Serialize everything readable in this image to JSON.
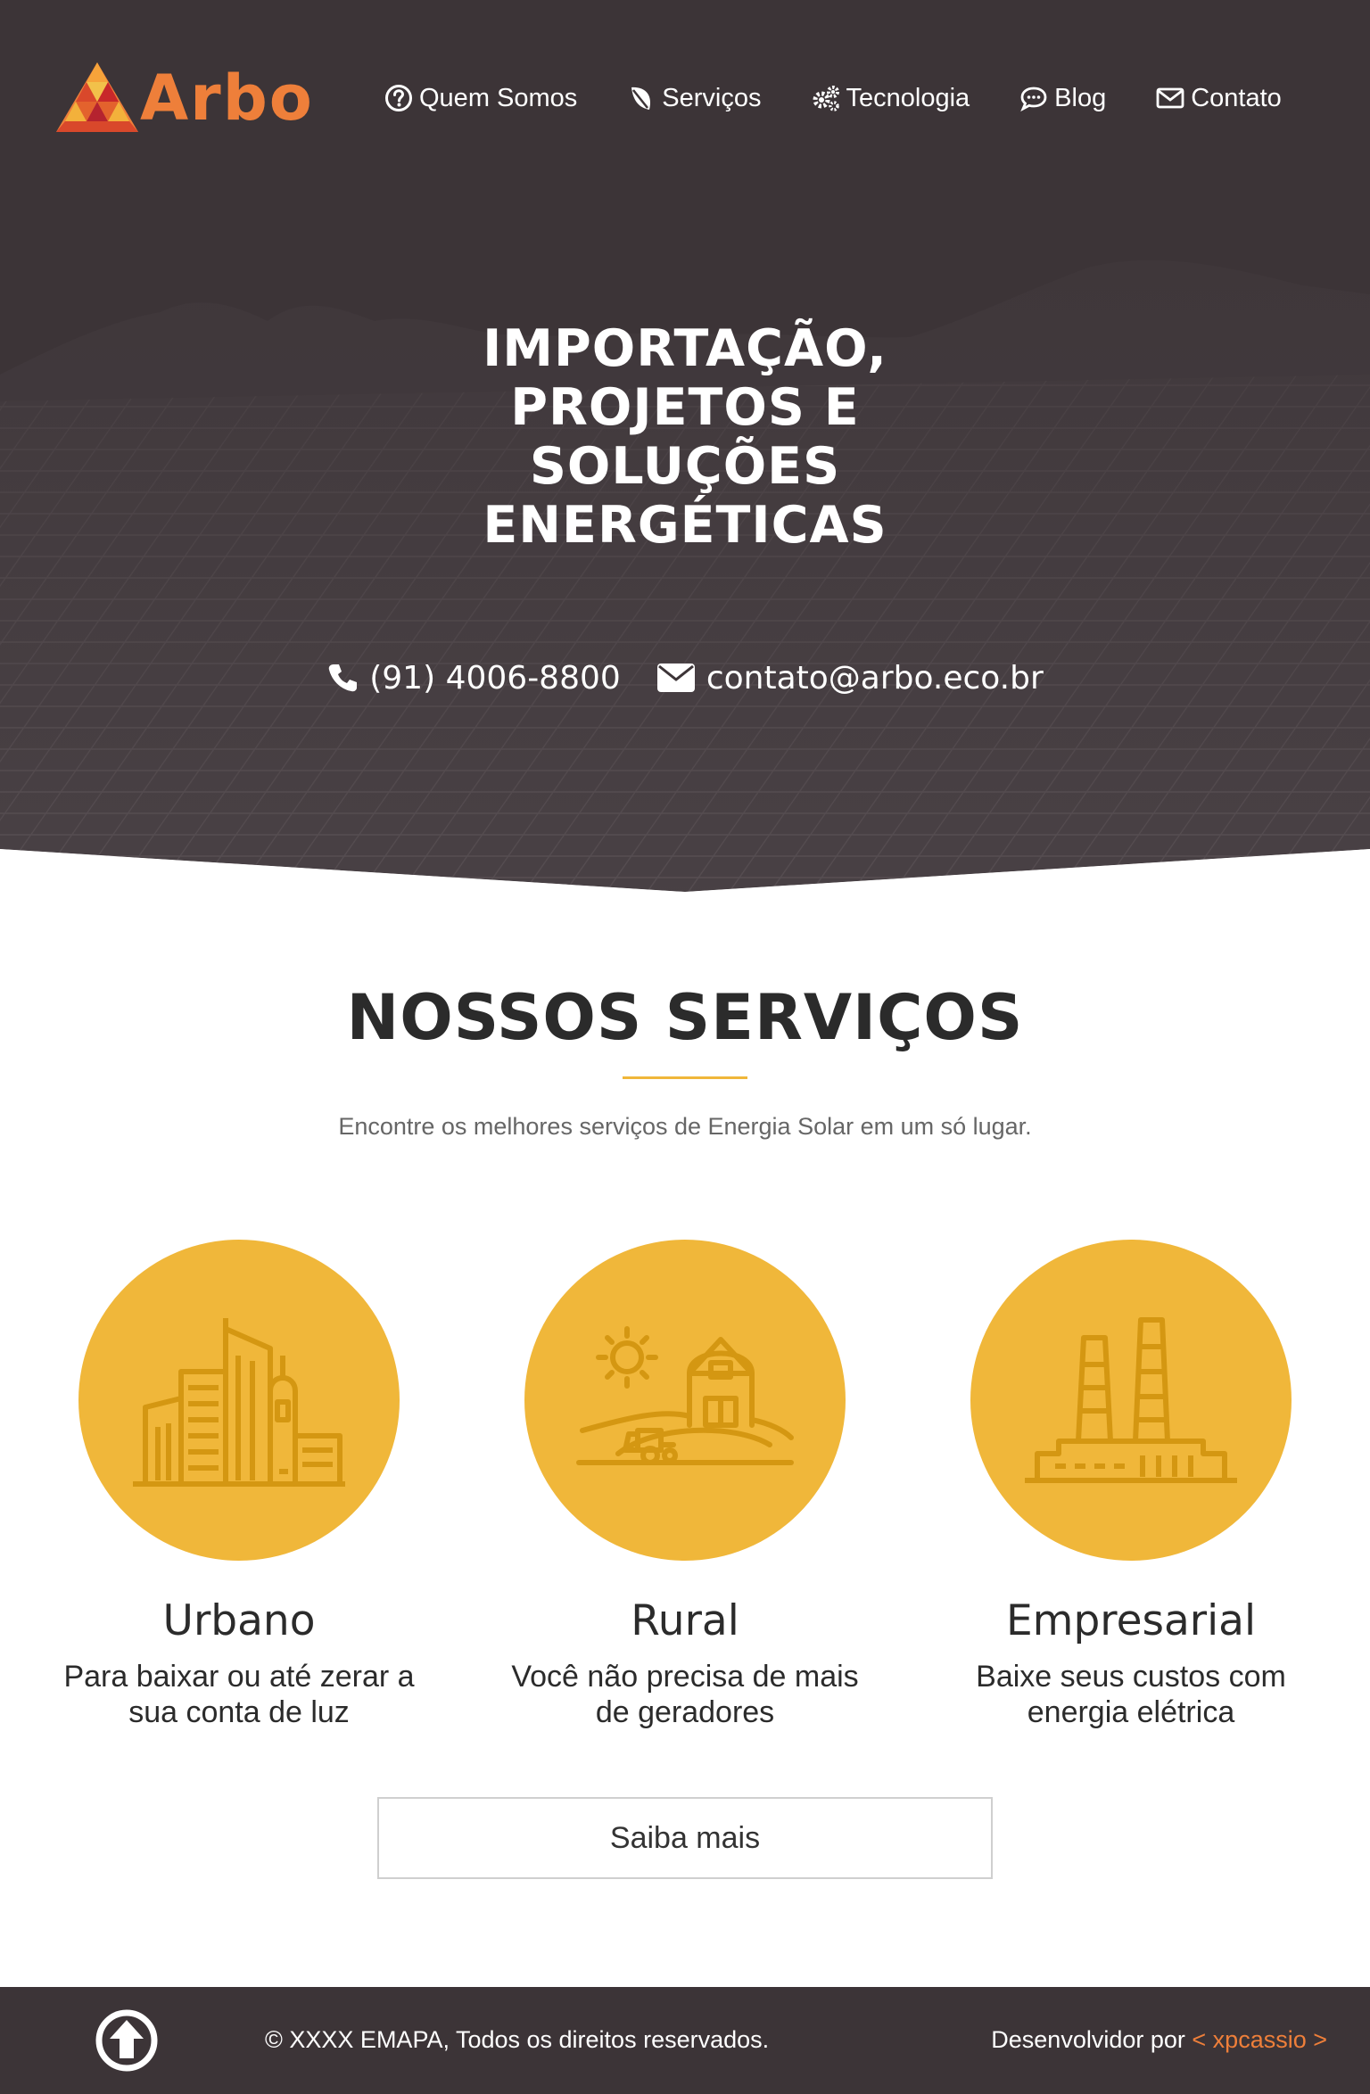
{
  "brand": {
    "name": "Arbo",
    "accent": "#ee7f3a",
    "yellow": "#f0b73a",
    "dark": "#3c3437"
  },
  "nav": {
    "items": [
      {
        "label": "Quem Somos",
        "icon": "question-circle-icon"
      },
      {
        "label": "Serviços",
        "icon": "leaf-icon"
      },
      {
        "label": "Tecnologia",
        "icon": "gears-icon"
      },
      {
        "label": "Blog",
        "icon": "comment-icon"
      },
      {
        "label": "Contato",
        "icon": "envelope-icon"
      }
    ]
  },
  "hero": {
    "title_lines": [
      "IMPORTAÇÃO,",
      "PROJETOS E",
      "SOLUÇÕES",
      "ENERGÉTICAS"
    ],
    "phone": "(91) 4006-8800",
    "email": "contato@arbo.eco.br"
  },
  "services": {
    "title": "NOSSOS SERVIÇOS",
    "subtitle": "Encontre os melhores serviços de Energia Solar em um só lugar.",
    "cards": [
      {
        "title": "Urbano",
        "desc_line1": "Para baixar ou até zerar a",
        "desc_line2": "sua conta de luz",
        "icon": "city-buildings-icon"
      },
      {
        "title": "Rural",
        "desc_line1": "Você não precisa de mais",
        "desc_line2": "de geradores",
        "icon": "farm-barn-icon"
      },
      {
        "title": "Empresarial",
        "desc_line1": "Baixe seus custos com",
        "desc_line2": "energia elétrica",
        "icon": "factory-icon"
      }
    ],
    "button_label": "Saiba mais"
  },
  "footer": {
    "copyright": "© XXXX EMAPA, Todos os direitos reservados.",
    "dev_prefix": "Desenvolvidor por",
    "dev_link": "< xpcassio >"
  }
}
